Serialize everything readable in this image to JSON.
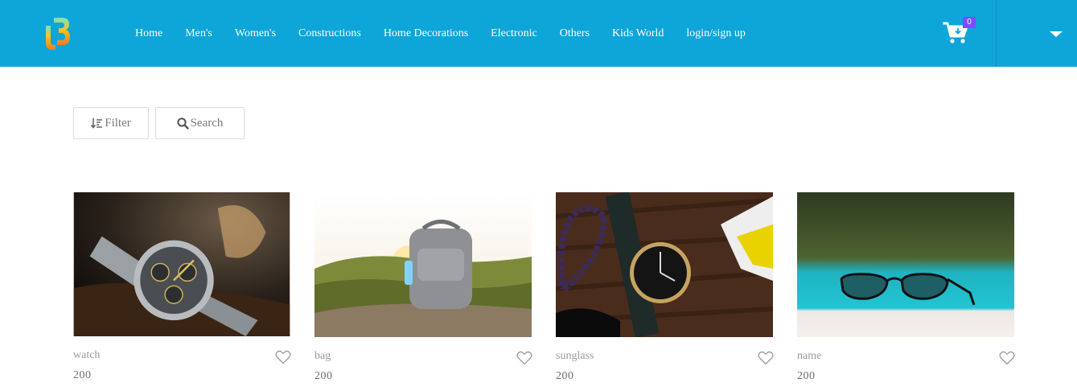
{
  "nav": {
    "links": [
      "Home",
      "Men's",
      "Women's",
      "Constructions",
      "Home Decorations",
      "Electronic",
      "Others",
      "Kids World",
      "login/sign up"
    ],
    "cart_count": "0",
    "brand_color": "#0ea5d9",
    "badge_color": "#7c4dff"
  },
  "toolbar": {
    "filter_label": "Filter",
    "search_label": "Search"
  },
  "products": [
    {
      "name": "watch",
      "price": "200"
    },
    {
      "name": "bag",
      "price": "200"
    },
    {
      "name": "sunglass",
      "price": "200"
    },
    {
      "name": "name",
      "price": "200"
    }
  ]
}
